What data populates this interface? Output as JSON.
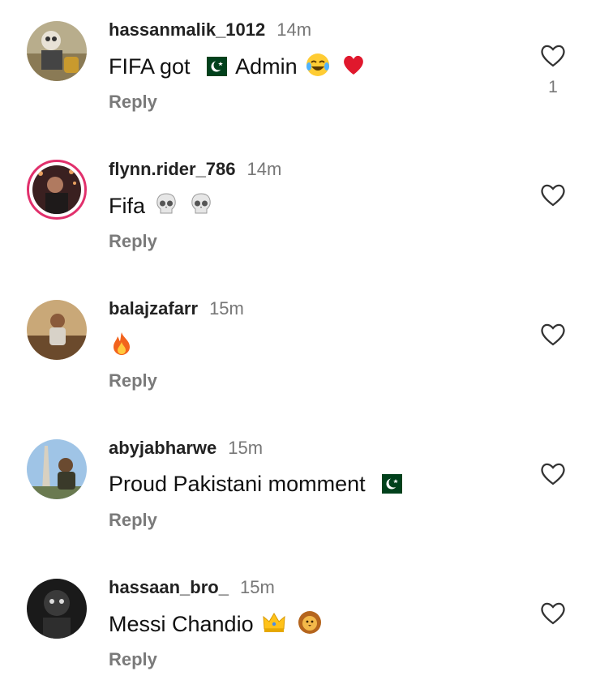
{
  "comments": [
    {
      "username": "hassanmalik_1012",
      "time": "14m",
      "text_parts": [
        "FIFA got",
        "Admin"
      ],
      "emojis": [
        "pakistan-flag",
        "tears-of-joy",
        "red-heart"
      ],
      "reply": "Reply",
      "likes": "1"
    },
    {
      "username": "flynn.rider_786",
      "time": "14m",
      "text": "Fifa",
      "emojis": [
        "skull",
        "skull"
      ],
      "reply": "Reply",
      "likes": ""
    },
    {
      "username": "balajzafarr",
      "time": "15m",
      "text": "",
      "emojis": [
        "fire"
      ],
      "reply": "Reply",
      "likes": ""
    },
    {
      "username": "abyjabharwe",
      "time": "15m",
      "text": "Proud Pakistani momment",
      "emojis": [
        "pakistan-flag"
      ],
      "reply": "Reply",
      "likes": ""
    },
    {
      "username": "hassaan_bro_",
      "time": "15m",
      "text": "Messi Chandio",
      "emojis": [
        "crown",
        "lion-face"
      ],
      "reply": "Reply",
      "likes": ""
    }
  ],
  "colors": {
    "story_ring": "#e1306c",
    "reply": "#7a7a7a",
    "time": "#777777",
    "pakistan_green": "#01411c"
  }
}
